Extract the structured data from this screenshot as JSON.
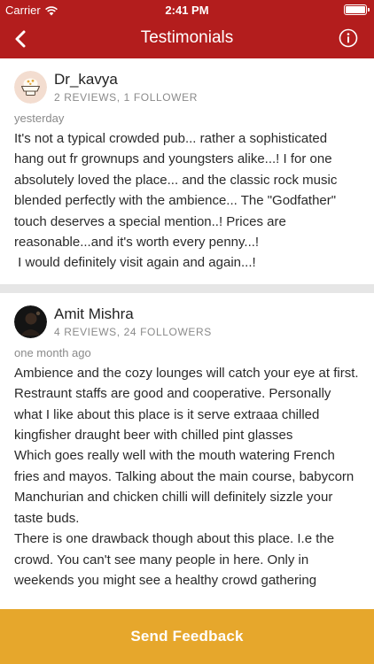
{
  "status_bar": {
    "carrier": "Carrier",
    "time": "2:41 PM",
    "battery_level": 1.0
  },
  "nav": {
    "title": "Testimonials",
    "back_icon": "chevron-left-icon",
    "info_icon": "info-icon"
  },
  "reviews": [
    {
      "author": "Dr_kavya",
      "meta": "2 REVIEWS, 1 FOLLOWER",
      "time": "yesterday",
      "text": "It's not a typical crowded pub... rather a sophisticated hang out fr grownups and youngsters alike...! I for one absolutely loved the place... and the classic rock music blended perfectly with the ambience... The \"Godfather\" touch deserves a special mention..! Prices are reasonable...and it's worth every penny...!\n I would definitely visit again and again...!"
    },
    {
      "author": "Amit Mishra",
      "meta": "4 REVIEWS, 24 FOLLOWERS",
      "time": "one month ago",
      "text": "Ambience and the cozy lounges will catch your eye at first. Restraunt staffs are good and cooperative. Personally what I like about this place is it serve extraaa chilled kingfisher draught beer with chilled pint glasses\nWhich goes really well with the mouth watering French fries and mayos. Talking about the main course, babycorn  Manchurian and chicken chilli will definitely sizzle your taste buds.\nThere is one drawback though about this place. I.e the crowd. You can't see many people in here. Only in weekends you might see a healthy crowd gathering"
    }
  ],
  "footer": {
    "button_label": "Send Feedback"
  },
  "colors": {
    "header": "#b31d1d",
    "footer": "#e6a72c",
    "separator": "#e6e6e6"
  }
}
